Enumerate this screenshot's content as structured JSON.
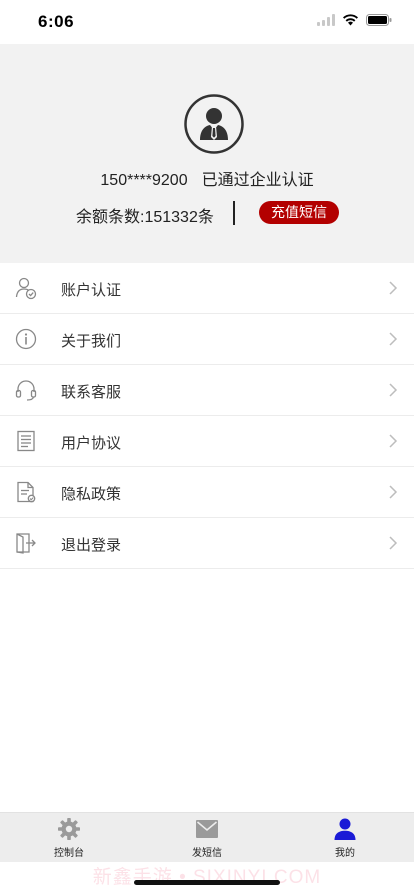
{
  "status_bar": {
    "time": "6:06",
    "icons": [
      "signal-icon",
      "wifi-icon",
      "battery-icon"
    ]
  },
  "profile": {
    "avatar_icon": "businessman-avatar-icon",
    "phone": "150****9200",
    "verification_status": "已通过企业认证",
    "balance_label": "余额条数:151332条",
    "recharge_button": "充值短信",
    "accent_color": "#b30000"
  },
  "menu": {
    "items": [
      {
        "label": "账户认证",
        "icon": "user-verify-icon"
      },
      {
        "label": "关于我们",
        "icon": "info-icon"
      },
      {
        "label": "联系客服",
        "icon": "headset-icon"
      },
      {
        "label": "用户协议",
        "icon": "document-icon"
      },
      {
        "label": "隐私政策",
        "icon": "privacy-doc-icon"
      },
      {
        "label": "退出登录",
        "icon": "logout-icon"
      }
    ]
  },
  "tab_bar": {
    "tabs": [
      {
        "label": "控制台",
        "icon": "gear-icon",
        "active": false
      },
      {
        "label": "发短信",
        "icon": "envelope-icon",
        "active": false
      },
      {
        "label": "我的",
        "icon": "person-icon",
        "active": true
      }
    ],
    "active_color": "#1a1ad6",
    "inactive_color": "#9a9a9a"
  },
  "watermark": "新鑫手游 • SIXINYI.COM"
}
